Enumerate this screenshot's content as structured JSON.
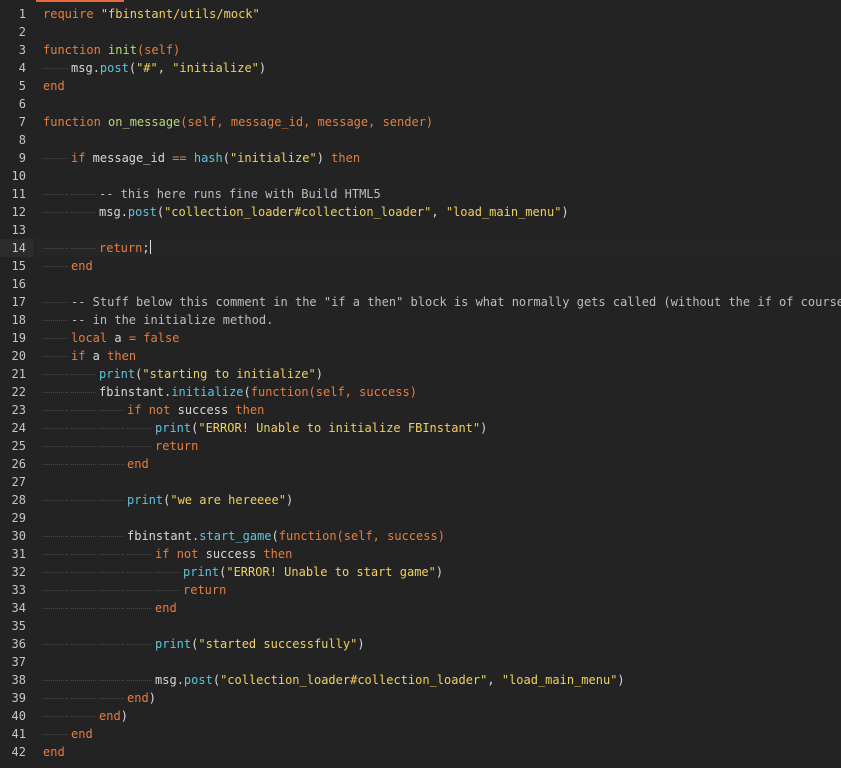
{
  "editor": {
    "accent_color": "#e66a3c",
    "background": "#232323",
    "active_line": 14,
    "colors": {
      "kw": "#e87d3e",
      "fn": "#5ec4dc",
      "def": "#b8d977",
      "str": "#f0d060",
      "cm": "#bdbdbd",
      "id": "#d8d8d8",
      "op": "#d8d8d8",
      "param": "#e87d3e"
    },
    "lines": [
      {
        "n": "1",
        "indent": 0,
        "tokens": [
          [
            "kw",
            "require"
          ],
          [
            "id",
            " "
          ],
          [
            "str",
            "\"fbinstant/utils/mock\""
          ]
        ]
      },
      {
        "n": "2",
        "indent": 0,
        "tokens": []
      },
      {
        "n": "3",
        "indent": 0,
        "tokens": [
          [
            "kw",
            "function"
          ],
          [
            "id",
            " "
          ],
          [
            "def",
            "init"
          ],
          [
            "param",
            "(self)"
          ]
        ]
      },
      {
        "n": "4",
        "indent": 1,
        "tokens": [
          [
            "id",
            "msg"
          ],
          [
            "op",
            "."
          ],
          [
            "fn",
            "post"
          ],
          [
            "op",
            "("
          ],
          [
            "str",
            "\"#\""
          ],
          [
            "op",
            ", "
          ],
          [
            "str",
            "\"initialize\""
          ],
          [
            "op",
            ")"
          ]
        ]
      },
      {
        "n": "5",
        "indent": 0,
        "tokens": [
          [
            "kw",
            "end"
          ]
        ]
      },
      {
        "n": "6",
        "indent": 0,
        "tokens": []
      },
      {
        "n": "7",
        "indent": 0,
        "tokens": [
          [
            "kw",
            "function"
          ],
          [
            "id",
            " "
          ],
          [
            "def",
            "on_message"
          ],
          [
            "param",
            "(self, message_id, message, sender)"
          ]
        ]
      },
      {
        "n": "8",
        "indent": 0,
        "tokens": []
      },
      {
        "n": "9",
        "indent": 1,
        "tokens": [
          [
            "kw",
            "if"
          ],
          [
            "id",
            " message_id "
          ],
          [
            "kw",
            "=="
          ],
          [
            "id",
            " "
          ],
          [
            "fn",
            "hash"
          ],
          [
            "op",
            "("
          ],
          [
            "str",
            "\"initialize\""
          ],
          [
            "op",
            ")"
          ],
          [
            "id",
            " "
          ],
          [
            "kw",
            "then"
          ]
        ]
      },
      {
        "n": "10",
        "indent": 0,
        "tokens": []
      },
      {
        "n": "11",
        "indent": 2,
        "tokens": [
          [
            "cm",
            "-- this here runs fine with Build HTML5"
          ]
        ]
      },
      {
        "n": "12",
        "indent": 2,
        "tokens": [
          [
            "id",
            "msg"
          ],
          [
            "op",
            "."
          ],
          [
            "fn",
            "post"
          ],
          [
            "op",
            "("
          ],
          [
            "str",
            "\"collection_loader#collection_loader\""
          ],
          [
            "op",
            ", "
          ],
          [
            "str",
            "\"load_main_menu\""
          ],
          [
            "op",
            ")"
          ]
        ]
      },
      {
        "n": "13",
        "indent": 0,
        "tokens": []
      },
      {
        "n": "14",
        "indent": 2,
        "tokens": [
          [
            "kw",
            "return"
          ],
          [
            "op",
            ";"
          ]
        ],
        "cursor": true
      },
      {
        "n": "15",
        "indent": 1,
        "tokens": [
          [
            "kw",
            "end"
          ]
        ]
      },
      {
        "n": "16",
        "indent": 0,
        "tokens": []
      },
      {
        "n": "17",
        "indent": 1,
        "tokens": [
          [
            "cm",
            "-- Stuff below this comment in the \"if a then\" block is what normally gets called (without the if of course)"
          ]
        ]
      },
      {
        "n": "18",
        "indent": 1,
        "tokens": [
          [
            "cm",
            "-- in the initialize method."
          ]
        ]
      },
      {
        "n": "19",
        "indent": 1,
        "tokens": [
          [
            "kw",
            "local"
          ],
          [
            "id",
            " a "
          ],
          [
            "kw",
            "="
          ],
          [
            "id",
            " "
          ],
          [
            "kw",
            "false"
          ]
        ]
      },
      {
        "n": "20",
        "indent": 1,
        "tokens": [
          [
            "kw",
            "if"
          ],
          [
            "id",
            " a "
          ],
          [
            "kw",
            "then"
          ]
        ]
      },
      {
        "n": "21",
        "indent": 2,
        "tokens": [
          [
            "fn",
            "print"
          ],
          [
            "op",
            "("
          ],
          [
            "str",
            "\"starting to initialize\""
          ],
          [
            "op",
            ")"
          ]
        ]
      },
      {
        "n": "22",
        "indent": 2,
        "tokens": [
          [
            "id",
            "fbinstant"
          ],
          [
            "op",
            "."
          ],
          [
            "fn",
            "initialize"
          ],
          [
            "op",
            "("
          ],
          [
            "kw",
            "function"
          ],
          [
            "param",
            "(self, success)"
          ]
        ]
      },
      {
        "n": "23",
        "indent": 3,
        "tokens": [
          [
            "kw",
            "if"
          ],
          [
            "id",
            " "
          ],
          [
            "kw",
            "not"
          ],
          [
            "id",
            " success "
          ],
          [
            "kw",
            "then"
          ]
        ]
      },
      {
        "n": "24",
        "indent": 4,
        "tokens": [
          [
            "fn",
            "print"
          ],
          [
            "op",
            "("
          ],
          [
            "str",
            "\"ERROR! Unable to initialize FBInstant\""
          ],
          [
            "op",
            ")"
          ]
        ]
      },
      {
        "n": "25",
        "indent": 4,
        "tokens": [
          [
            "kw",
            "return"
          ]
        ]
      },
      {
        "n": "26",
        "indent": 3,
        "tokens": [
          [
            "kw",
            "end"
          ]
        ]
      },
      {
        "n": "27",
        "indent": 0,
        "tokens": []
      },
      {
        "n": "28",
        "indent": 3,
        "tokens": [
          [
            "fn",
            "print"
          ],
          [
            "op",
            "("
          ],
          [
            "str",
            "\"we are hereeee\""
          ],
          [
            "op",
            ")"
          ]
        ]
      },
      {
        "n": "29",
        "indent": 0,
        "tokens": []
      },
      {
        "n": "30",
        "indent": 3,
        "tokens": [
          [
            "id",
            "fbinstant"
          ],
          [
            "op",
            "."
          ],
          [
            "fn",
            "start_game"
          ],
          [
            "op",
            "("
          ],
          [
            "kw",
            "function"
          ],
          [
            "param",
            "(self, success)"
          ]
        ]
      },
      {
        "n": "31",
        "indent": 4,
        "tokens": [
          [
            "kw",
            "if"
          ],
          [
            "id",
            " "
          ],
          [
            "kw",
            "not"
          ],
          [
            "id",
            " success "
          ],
          [
            "kw",
            "then"
          ]
        ]
      },
      {
        "n": "32",
        "indent": 5,
        "tokens": [
          [
            "fn",
            "print"
          ],
          [
            "op",
            "("
          ],
          [
            "str",
            "\"ERROR! Unable to start game\""
          ],
          [
            "op",
            ")"
          ]
        ]
      },
      {
        "n": "33",
        "indent": 5,
        "tokens": [
          [
            "kw",
            "return"
          ]
        ]
      },
      {
        "n": "34",
        "indent": 4,
        "tokens": [
          [
            "kw",
            "end"
          ]
        ]
      },
      {
        "n": "35",
        "indent": 0,
        "tokens": []
      },
      {
        "n": "36",
        "indent": 4,
        "tokens": [
          [
            "fn",
            "print"
          ],
          [
            "op",
            "("
          ],
          [
            "str",
            "\"started successfully\""
          ],
          [
            "op",
            ")"
          ]
        ]
      },
      {
        "n": "37",
        "indent": 0,
        "tokens": []
      },
      {
        "n": "38",
        "indent": 4,
        "tokens": [
          [
            "id",
            "msg"
          ],
          [
            "op",
            "."
          ],
          [
            "fn",
            "post"
          ],
          [
            "op",
            "("
          ],
          [
            "str",
            "\"collection_loader#collection_loader\""
          ],
          [
            "op",
            ", "
          ],
          [
            "str",
            "\"load_main_menu\""
          ],
          [
            "op",
            ")"
          ]
        ]
      },
      {
        "n": "39",
        "indent": 3,
        "tokens": [
          [
            "kw",
            "end"
          ],
          [
            "op",
            ")"
          ]
        ]
      },
      {
        "n": "40",
        "indent": 2,
        "tokens": [
          [
            "kw",
            "end"
          ],
          [
            "op",
            ")"
          ]
        ]
      },
      {
        "n": "41",
        "indent": 1,
        "tokens": [
          [
            "kw",
            "end"
          ]
        ]
      },
      {
        "n": "42",
        "indent": 0,
        "tokens": [
          [
            "kw",
            "end"
          ]
        ]
      }
    ]
  }
}
